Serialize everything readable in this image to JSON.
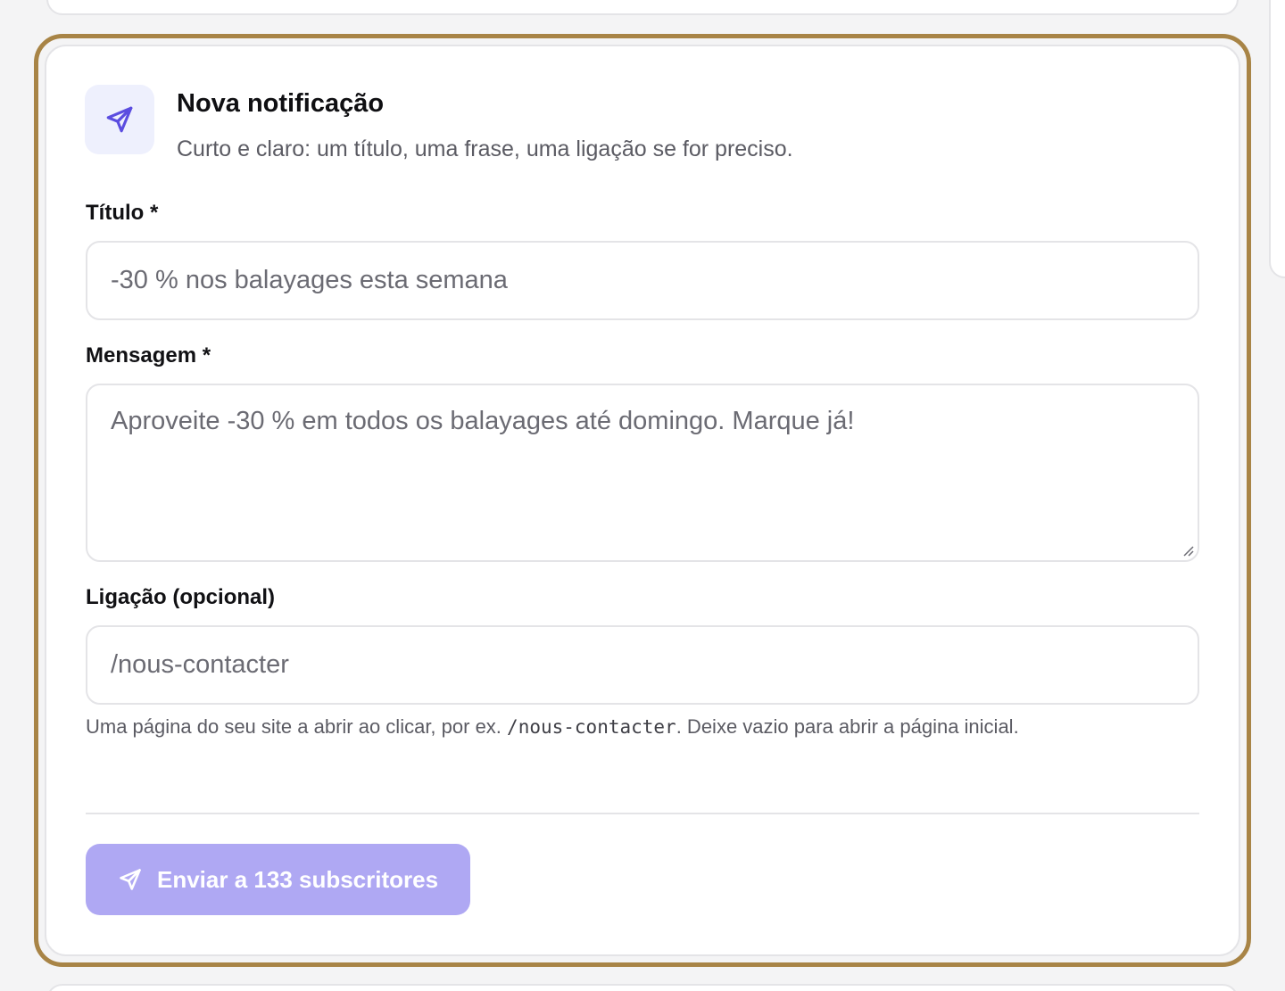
{
  "card": {
    "title": "Nova notificação",
    "subtitle": "Curto e claro: um título, uma frase, uma ligação se for preciso.",
    "icon": "paper-plane-icon",
    "accent_color": "#5b4de0",
    "focus_ring_color": "#a88446"
  },
  "form": {
    "title_label": "Título *",
    "title_value": "-30 % nos balayages esta semana",
    "message_label": "Mensagem *",
    "message_value": "Aproveite -30 % em todos os balayages até domingo. Marque já!",
    "link_label": "Ligação (opcional)",
    "link_value": "/nous-contacter",
    "help_prefix": "Uma página do seu site a abrir ao clicar, por ex.",
    "help_code": "/nous-contacter",
    "help_suffix": ". Deixe vazio para abrir a página inicial."
  },
  "submit": {
    "label": "Enviar a 133 subscritores",
    "icon": "paper-plane-icon",
    "background_color": "#afa8f3"
  }
}
